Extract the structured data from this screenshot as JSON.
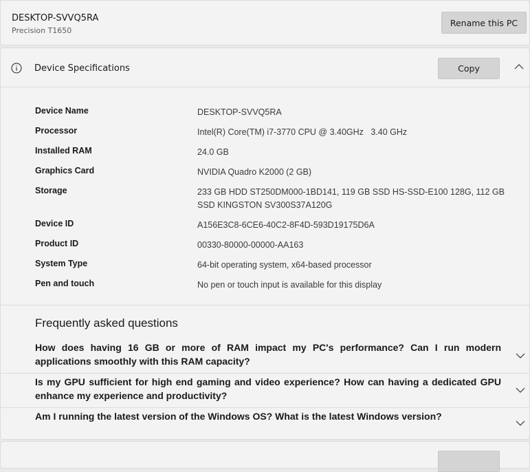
{
  "pc": {
    "name": "DESKTOP-SVVQ5RA",
    "model": "Precision T1650",
    "rename_label": "Rename this PC"
  },
  "specs": {
    "title": "Device Specifications",
    "copy_label": "Copy",
    "rows": [
      {
        "label": "Device Name",
        "value": "DESKTOP-SVVQ5RA"
      },
      {
        "label": "Processor",
        "value": "Intel(R) Core(TM) i7-3770 CPU @ 3.40GHz   3.40 GHz"
      },
      {
        "label": "Installed RAM",
        "value": "24.0 GB"
      },
      {
        "label": "Graphics Card",
        "value": "NVIDIA Quadro K2000 (2 GB)"
      },
      {
        "label": "Storage",
        "value": "233 GB HDD ST250DM000-1BD141, 119 GB SSD HS-SSD-E100 128G, 112 GB SSD KINGSTON SV300S37A120G"
      },
      {
        "label": "Device ID",
        "value": "A156E3C8-6CE6-40C2-8F4D-593D19175D6A"
      },
      {
        "label": "Product ID",
        "value": "00330-80000-00000-AA163"
      },
      {
        "label": "System Type",
        "value": "64-bit operating system, x64-based processor"
      },
      {
        "label": "Pen and touch",
        "value": "No pen or touch input is available for this display"
      }
    ]
  },
  "faq": {
    "title": "Frequently asked questions",
    "items": [
      {
        "question": "How does having 16 GB or more of RAM impact my PC's performance? Can I run modern applications smoothly with this RAM capacity?"
      },
      {
        "question": "Is my GPU sufficient for high end gaming and video experience? How can having a dedicated GPU enhance my experience and productivity?"
      },
      {
        "question": "Am I running the latest version of the Windows OS? What is the latest Windows version?"
      }
    ]
  },
  "icons": {
    "info": "info-icon",
    "collapse": "chevron-up-icon",
    "expand": "chevron-down-icon"
  }
}
